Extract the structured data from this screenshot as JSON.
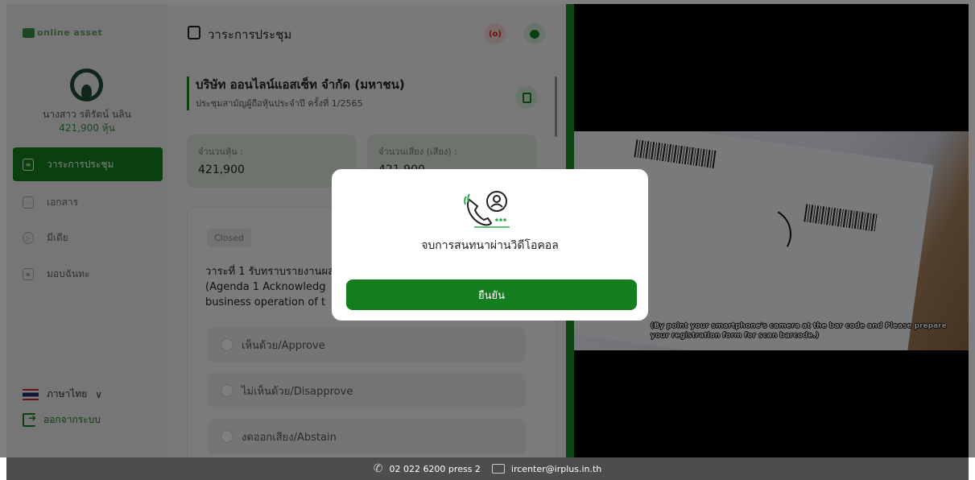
{
  "brand": {
    "logo_text": "online asset"
  },
  "user": {
    "name": "นางสาว รติรัตน์ นลิน",
    "shares": "421,900 หุ้น"
  },
  "nav": {
    "items": [
      {
        "label": "วาระการประชุม",
        "icon": "agenda-icon",
        "active": true
      },
      {
        "label": "เอกสาร",
        "icon": "document-icon",
        "active": false
      },
      {
        "label": "มีเดีย",
        "icon": "media-play-icon",
        "active": false
      },
      {
        "label": "มอบฉันทะ",
        "icon": "proxy-icon",
        "active": false
      }
    ]
  },
  "language": {
    "label": "ภาษาไทย",
    "chevron": "∨"
  },
  "logout": {
    "label": "ออกจากระบบ"
  },
  "header": {
    "title": "วาระการประชุม",
    "live_label": "(o)"
  },
  "company": {
    "name": "บริษัท ออนไลน์แอสเซ็ท จำกัด (มหาชน)",
    "meeting": "ประชุมสามัญผู้ถือหุ้นประจำปี ครั้งที่ 1/2565"
  },
  "cards": {
    "shares_label": "จำนวนหุ้น :",
    "shares_value": "421,900",
    "votes_label": "จำนวนเสียง (เสียง) :",
    "votes_value": "421,900"
  },
  "agenda": {
    "status": "Closed",
    "line1": "วาระที่ 1 รับทราบรายงานผล",
    "line2": "(Agenda 1 Acknowledg",
    "line3": "business operation of t",
    "options": [
      {
        "label": "เห็นด้วย/Approve"
      },
      {
        "label": "ไม่เห็นด้วย/Disapprove"
      },
      {
        "label": "งดออกเสียง/Abstain"
      }
    ]
  },
  "video": {
    "subtitle": "(By point your smartphone's camera at the bar code and Please prepare your registration form for scan barcode.)"
  },
  "modal": {
    "title": "จบการสนทนาผ่านวิดีโอคอล",
    "confirm_label": "ยืนยัน"
  },
  "footer": {
    "phone": "02 022 6200 press 2",
    "email": "ircenter@irplus.in.th"
  },
  "colors": {
    "primary": "#157f1f",
    "divider": "#1f8a2b",
    "card_bg": "#dde9db",
    "footer_bg": "#4d4d4d"
  }
}
